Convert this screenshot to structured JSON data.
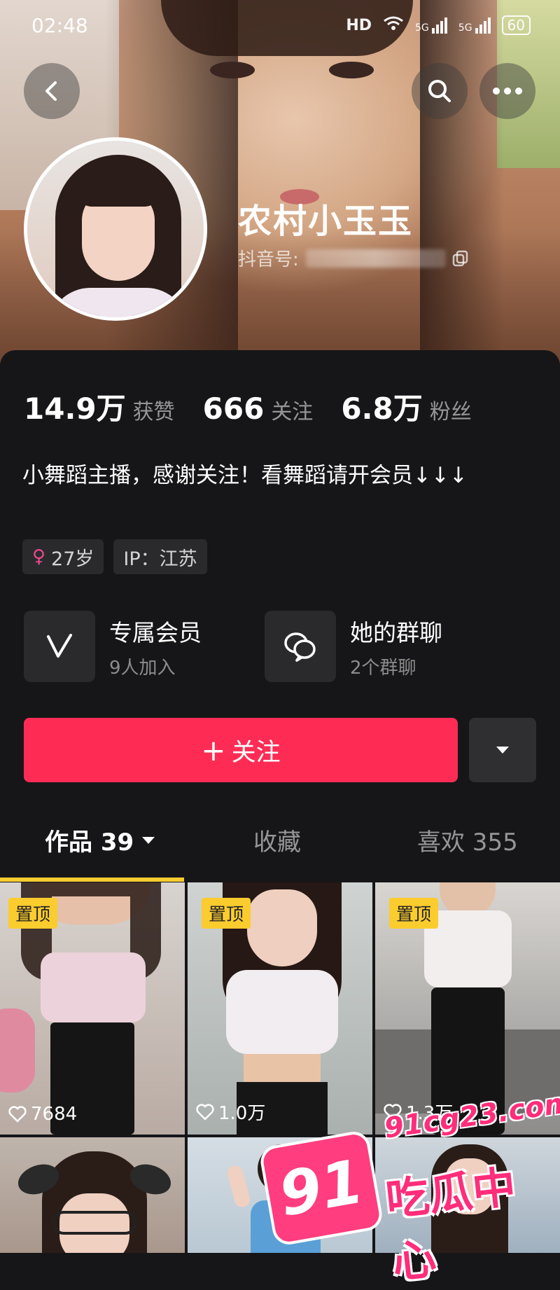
{
  "status_bar": {
    "time": "02:48",
    "network": "HD",
    "signal1": "5G",
    "signal2": "5G",
    "battery": "60"
  },
  "profile": {
    "name": "农村小玉玉",
    "douyin_id_label": "抖音号: ",
    "stats": [
      {
        "value": "14.9万",
        "label": "获赞"
      },
      {
        "value": "666",
        "label": "关注"
      },
      {
        "value": "6.8万",
        "label": "粉丝"
      }
    ],
    "bio": "小舞蹈主播，感谢关注！看舞蹈请开会员↓↓↓",
    "tags": {
      "gender_symbol": "♀",
      "age": "27岁",
      "ip": "IP：江苏"
    },
    "features": [
      {
        "title": "专属会员",
        "subtitle": "9人加入",
        "icon": "v-member-icon"
      },
      {
        "title": "她的群聊",
        "subtitle": "2个群聊",
        "icon": "group-chat-icon"
      }
    ]
  },
  "actions": {
    "follow_label": "关注",
    "follow_plus": "+"
  },
  "tabs": {
    "works": "作品 39",
    "favorites": "收藏",
    "likes": "喜欢 355"
  },
  "videos": [
    {
      "pinned": "置顶",
      "likes": "7684"
    },
    {
      "pinned": "置顶",
      "likes": "1.0万"
    },
    {
      "pinned": "置顶",
      "likes": "1.3万"
    }
  ],
  "watermark": {
    "url": "91cg23.com",
    "badge": "91",
    "text": "吃瓜中心"
  },
  "colors": {
    "accent": "#fe2c55",
    "pin": "#facc2e",
    "background": "#161618"
  }
}
